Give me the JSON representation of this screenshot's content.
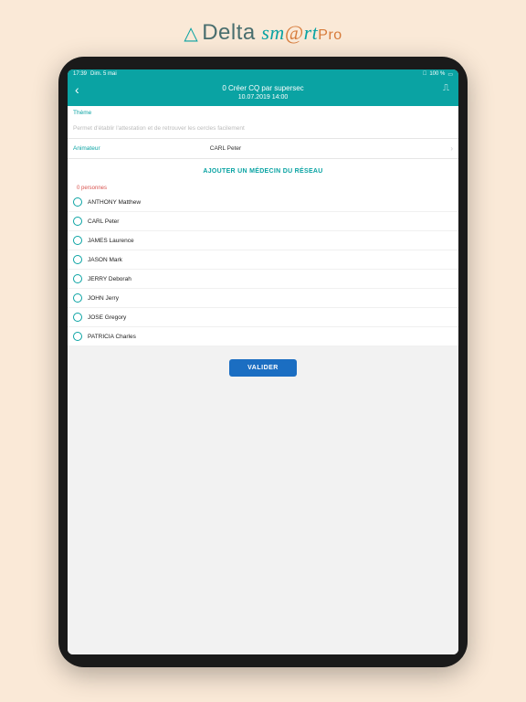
{
  "brand": {
    "triangle": "△",
    "delta": "Delta",
    "sm": "sm",
    "at": "@",
    "rt": "rt",
    "pro": "Pro"
  },
  "status": {
    "time": "17:39",
    "date": "Dim. 5 mai",
    "battery": "100 %",
    "wifi": "􀙇"
  },
  "nav": {
    "back": "‹",
    "title": "0 Créer CQ par supersec",
    "subtitle": "10.07.2019 14:00",
    "action_icon": "⎍"
  },
  "theme": {
    "label": "Thème",
    "placeholder": "Permet d'établir l'attestation et de retrouver les cercles facilement"
  },
  "animateur": {
    "label": "Animateur",
    "value": "CARL Peter",
    "chevron": "›"
  },
  "add_doctor_label": "AJOUTER UN MÉDECIN DU RÉSEAU",
  "count_label": "0 personnes",
  "people": [
    {
      "name": "ANTHONY Matthew"
    },
    {
      "name": "CARL Peter"
    },
    {
      "name": "JAMES Laurence"
    },
    {
      "name": "JASON Mark"
    },
    {
      "name": "JERRY Deborah"
    },
    {
      "name": "JOHN Jerry"
    },
    {
      "name": "JOSE Gregory"
    },
    {
      "name": "PATRICIA Charles"
    }
  ],
  "validate_label": "VALIDER"
}
